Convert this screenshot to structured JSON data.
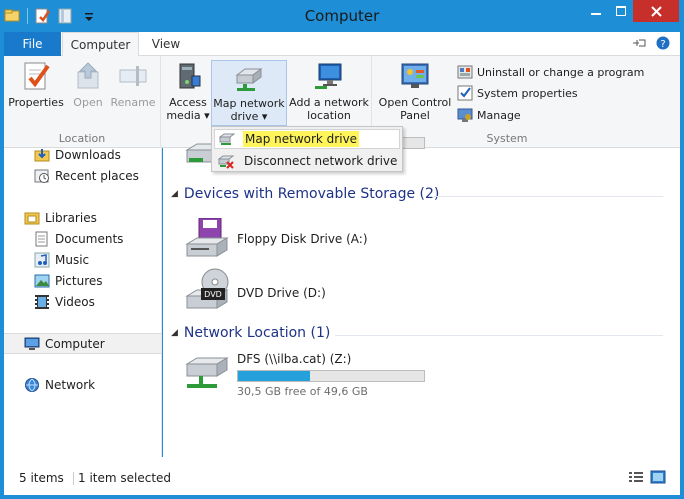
{
  "window": {
    "title": "Computer",
    "accent": "#1e8fd6",
    "close_color": "#c7302a",
    "controls": {
      "minimize": "−",
      "maximize": "□",
      "close": "✕"
    }
  },
  "tabs": {
    "file": "File",
    "computer": "Computer",
    "view": "View"
  },
  "ribbon": {
    "location_group": {
      "label": "Location",
      "properties": "Properties",
      "open": "Open",
      "rename": "Rename"
    },
    "network_group": {
      "access_media_1": "Access",
      "access_media_2": "media",
      "map_drive_1": "Map network",
      "map_drive_2": "drive",
      "add_location_1": "Add a network",
      "add_location_2": "location"
    },
    "system_group": {
      "label": "System",
      "control_panel_1": "Open Control",
      "control_panel_2": "Panel",
      "uninstall": "Uninstall or change a program",
      "system_properties": "System properties",
      "manage": "Manage"
    }
  },
  "dropdown": {
    "items": [
      {
        "label": "Map network drive",
        "icon": "map-drive-icon"
      },
      {
        "label": "Disconnect network drive",
        "icon": "disconnect-drive-icon"
      }
    ]
  },
  "nav": {
    "downloads": "Downloads",
    "recent_places": "Recent places",
    "libraries": "Libraries",
    "documents": "Documents",
    "music": "Music",
    "pictures": "Pictures",
    "videos": "Videos",
    "computer": "Computer",
    "network": "Network"
  },
  "content": {
    "removable_header": "Devices with Removable Storage (2)",
    "network_header": "Network Location (1)",
    "drives": {
      "floppy": "Floppy Disk Drive (A:)",
      "dvd": "DVD Drive (D:)",
      "dvd_badge": "DVD",
      "dfs": "DFS (\\\\ilba.cat) (Z:)",
      "dfs_free": "30,5 GB free of 49,6 GB",
      "dfs_used_fraction": 0.385
    }
  },
  "status": {
    "items": "5 items",
    "selected": "1 item selected"
  }
}
